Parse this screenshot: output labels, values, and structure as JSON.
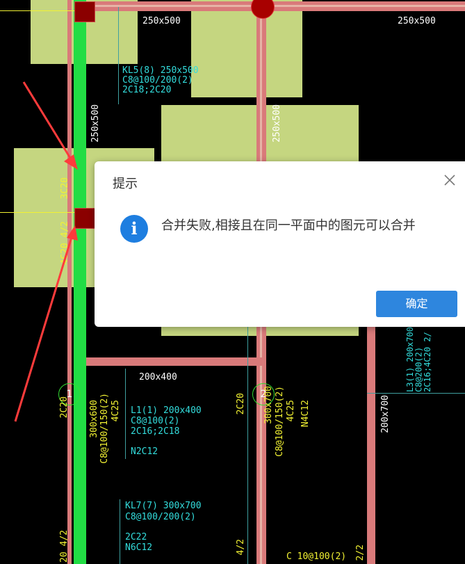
{
  "dialog": {
    "title": "提示",
    "message": "合并失败,相接且在同一平面中的图元可以合并",
    "confirm_label": "确定"
  },
  "drawing_labels": {
    "beam_top_left": "250x500",
    "beam_top_right": "250x500",
    "kl5_line1": "KL5(8) 250x500",
    "kl5_line2": "C8@100/200(2)",
    "kl5_line3": "2C18;2C20",
    "vert_250_left": "250x500",
    "vert_250_mid": "250x500",
    "green_3c20": "3C20",
    "green_4c20": "4C20 4/2",
    "beam_200x400": "200x400",
    "l1_line1": "L1(1) 200x400",
    "l1_line2": "C8@100(2)",
    "l1_line3": "2C16;2C18",
    "l1_line4": "N2C12",
    "v_2c20_left": "2C20",
    "v_300x600": "300x600",
    "v_c8_150": "C8@100/150(2)",
    "v_4c25": "4C25",
    "v_2c20_mid": "2C20",
    "v_300x700": "300x700",
    "v_c8_150_mid": "C8@100/150(2)",
    "v_4c25_mid": "4C25",
    "v_n4c12": "N4C12",
    "v_200x700": "200x700",
    "l3_text": "L3(1) 200x700\nC8@200(2)\n2C16;4C20 2/",
    "kl7_line1": "KL7(7) 300x700",
    "kl7_line2": "C8@100/200(2)",
    "kl7_line3": "2C22",
    "kl7_line4": "N6C12",
    "bottom_left": "20 4/2",
    "bottom_mid": "4/2",
    "bottom_c10": "C 10@100(2)",
    "bottom_right": "2/2",
    "axis_marker_1": "1",
    "axis_marker_2": "2"
  },
  "colors": {
    "background": "#000000",
    "slab": "#c5d680",
    "beam": "#d97a7a",
    "selected_beam": "#22dd44",
    "column": "#8b0000",
    "annotation_yellow": "#f2f233",
    "annotation_cyan": "#33dddd",
    "arrow": "#ff3b3b",
    "dialog_button": "#2e86de",
    "info_icon": "#1e7ee0"
  },
  "icons": [
    "info-icon",
    "close-icon"
  ]
}
